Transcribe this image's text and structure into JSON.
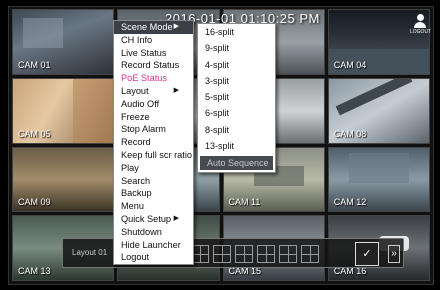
{
  "timestamp": "2016-01-01 01:10:25 PM",
  "logout_label": "LOGOUT",
  "cameras": [
    {
      "label": "CAM 01"
    },
    {
      "label": ""
    },
    {
      "label": ""
    },
    {
      "label": "CAM 04"
    },
    {
      "label": "CAM 05"
    },
    {
      "label": ""
    },
    {
      "label": ""
    },
    {
      "label": "CAM 08"
    },
    {
      "label": "CAM 09"
    },
    {
      "label": ""
    },
    {
      "label": "CAM 11"
    },
    {
      "label": "CAM 12"
    },
    {
      "label": "CAM 13"
    },
    {
      "label": ""
    },
    {
      "label": "CAM 15"
    },
    {
      "label": "CAM 16"
    }
  ],
  "launcher": {
    "layout_label": "Layout 01",
    "more_glyph": "»",
    "sequence_glyph": "✓"
  },
  "context_menu": {
    "items": [
      {
        "label": "Scene Mode",
        "arrow": "▶"
      },
      {
        "label": "CH Info",
        "arrow": ""
      },
      {
        "label": "Live Status",
        "arrow": ""
      },
      {
        "label": "Record Status",
        "arrow": ""
      },
      {
        "label": "PoE Status",
        "arrow": ""
      },
      {
        "label": "Layout",
        "arrow": "▶"
      },
      {
        "label": "Audio Off",
        "arrow": ""
      },
      {
        "label": "Freeze",
        "arrow": ""
      },
      {
        "label": "Stop Alarm",
        "arrow": ""
      },
      {
        "label": "Record",
        "arrow": ""
      },
      {
        "label": "Keep full scr ratio",
        "arrow": ""
      },
      {
        "label": "Play",
        "arrow": ""
      },
      {
        "label": "Search",
        "arrow": ""
      },
      {
        "label": "Backup",
        "arrow": ""
      },
      {
        "label": "Menu",
        "arrow": ""
      },
      {
        "label": "Quick Setup",
        "arrow": "▶"
      },
      {
        "label": "Shutdown",
        "arrow": ""
      },
      {
        "label": "Hide Launcher",
        "arrow": ""
      },
      {
        "label": "Logout",
        "arrow": ""
      }
    ],
    "selected_item": "Scene Mode",
    "highlight_color": "#e0308f"
  },
  "scene_submenu": {
    "items": [
      "16-split",
      "9-split",
      "4-split",
      "3-split",
      "5-split",
      "6-split",
      "8-split",
      "13-split"
    ],
    "disabled_item": "Auto Sequence"
  }
}
